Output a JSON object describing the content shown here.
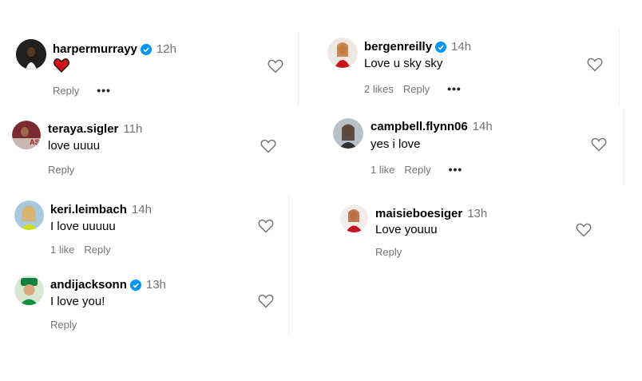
{
  "comments": [
    {
      "username": "harpermurrayy",
      "verified": true,
      "time": "12h",
      "text": "",
      "emoji": "heart",
      "likes": "",
      "reply": "Reply",
      "more": "•••"
    },
    {
      "username": "bergenreilly",
      "verified": true,
      "time": "14h",
      "text": "Love u sky sky",
      "likes": "2 likes",
      "reply": "Reply",
      "more": "•••"
    },
    {
      "username": "teraya.sigler",
      "verified": false,
      "time": "11h",
      "text": "love uuuu",
      "likes": "",
      "reply": "Reply"
    },
    {
      "username": "campbell.flynn06",
      "verified": false,
      "time": "14h",
      "text": "yes i love",
      "likes": "1 like",
      "reply": "Reply",
      "more": "•••"
    },
    {
      "username": "keri.leimbach",
      "verified": false,
      "time": "14h",
      "text": "I love uuuuu",
      "likes": "1 like",
      "reply": "Reply"
    },
    {
      "username": "maisieboesiger",
      "verified": false,
      "time": "13h",
      "text": "Love youuu",
      "likes": "",
      "reply": "Reply"
    },
    {
      "username": "andijacksonn",
      "verified": true,
      "time": "13h",
      "text": "I love you!",
      "likes": "",
      "reply": "Reply"
    }
  ],
  "colors": {
    "verified": "#0095f6",
    "like_heart": "#ed4956",
    "secondary": "#737373"
  }
}
